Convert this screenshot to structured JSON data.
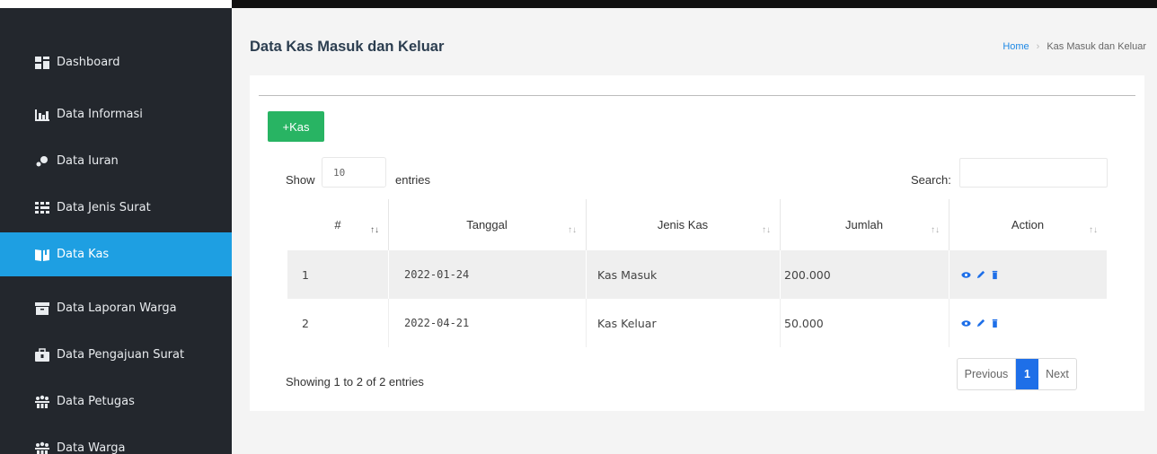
{
  "sidebar": {
    "items": [
      {
        "label": "Dashboard",
        "icon": "dashboard-icon"
      },
      {
        "label": "Data Informasi",
        "icon": "bar-chart-icon"
      },
      {
        "label": "Data Iuran",
        "icon": "coins-icon"
      },
      {
        "label": "Data Jenis Surat",
        "icon": "grid-icon"
      },
      {
        "label": "Data Kas",
        "icon": "book-icon",
        "active": true
      },
      {
        "label": "Data Laporan Warga",
        "icon": "archive-icon"
      },
      {
        "label": "Data Pengajuan Surat",
        "icon": "briefcase-icon"
      },
      {
        "label": "Data Petugas",
        "icon": "users-icon"
      },
      {
        "label": "Data Warga",
        "icon": "users-icon"
      }
    ]
  },
  "header": {
    "title": "Data Kas Masuk dan Keluar",
    "breadcrumb": {
      "home": "Home",
      "current": "Kas Masuk dan Keluar"
    }
  },
  "toolbar": {
    "add_label": "+Kas"
  },
  "table_controls": {
    "show_label": "Show",
    "page_length": "10",
    "entries_label": "entries",
    "search_label": "Search:",
    "search_value": ""
  },
  "table": {
    "columns": [
      "#",
      "Tanggal",
      "Jenis Kas",
      "Jumlah",
      "Action"
    ],
    "rows": [
      {
        "no": "1",
        "tanggal": "2022-01-24",
        "jenis": "Kas Masuk",
        "jumlah": "200.000"
      },
      {
        "no": "2",
        "tanggal": "2022-04-21",
        "jenis": "Kas Keluar",
        "jumlah": "50.000"
      }
    ]
  },
  "footer": {
    "info": "Showing 1 to 2 of 2 entries",
    "pagination": {
      "previous": "Previous",
      "current": "1",
      "next": "Next"
    }
  },
  "colors": {
    "sidebar_bg": "#23272d",
    "active": "#1e9fe2",
    "add_button": "#28b463",
    "pager_active": "#1e6fe8",
    "action_icon": "#1e6fe8"
  }
}
